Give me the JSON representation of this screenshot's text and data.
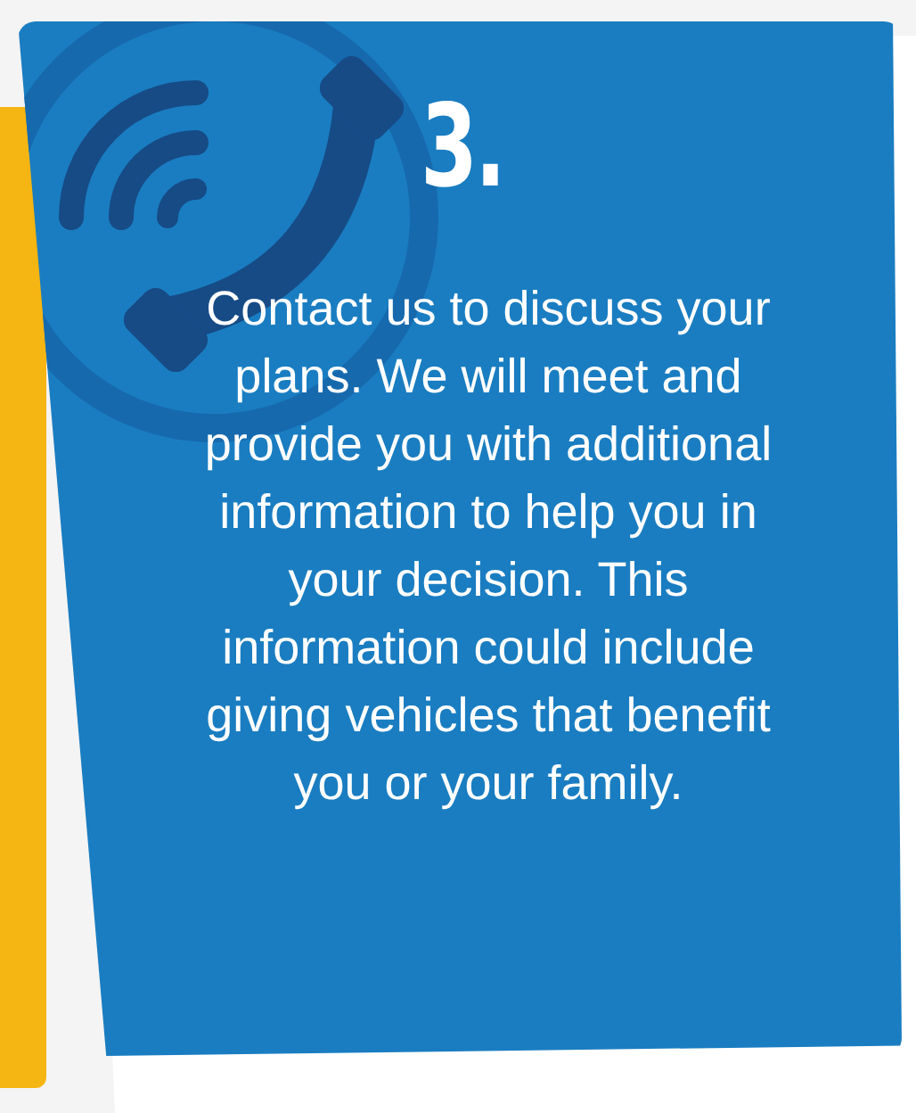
{
  "step": {
    "number": "3.",
    "text": "Contact us to discuss your plans. We will meet and provide you with additional information to help you in your decision. This information could include giving vehicles that benefit you or your family."
  }
}
